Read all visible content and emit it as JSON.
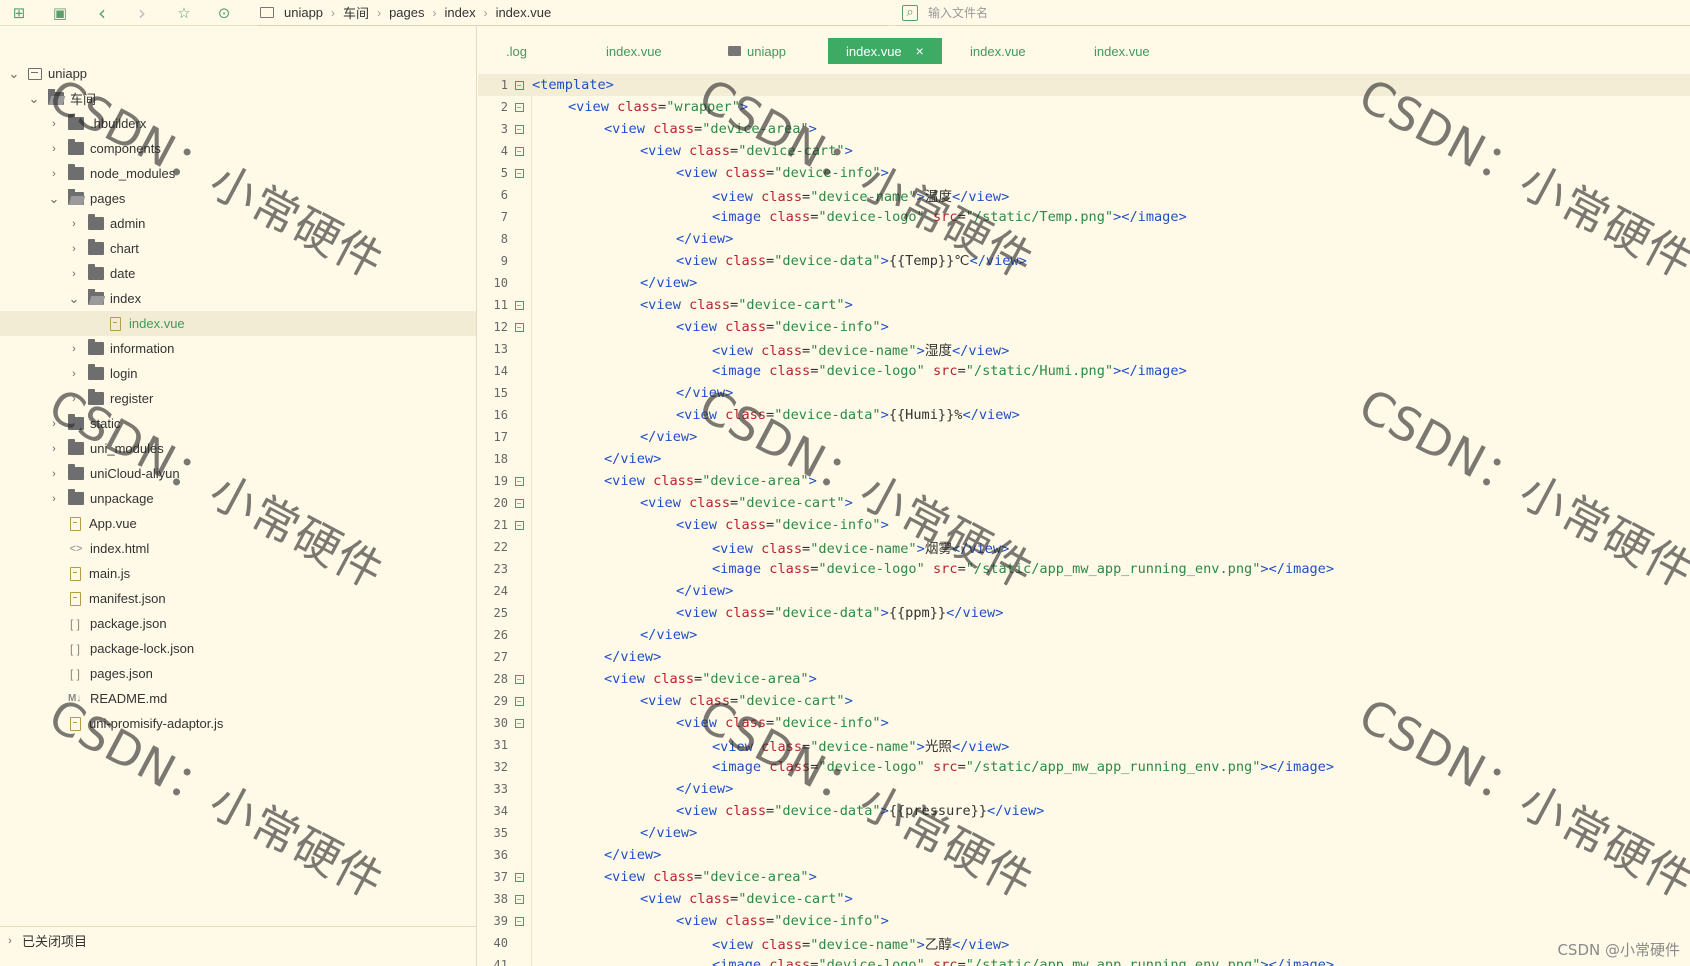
{
  "toolbar": {
    "buttons": [
      "new-file-icon",
      "save-icon",
      "back-icon",
      "forward-icon",
      "star-icon",
      "run-icon"
    ]
  },
  "breadcrumb": [
    "uniapp",
    "车间",
    "pages",
    "index",
    "index.vue"
  ],
  "search": {
    "placeholder": "输入文件名"
  },
  "tree": [
    {
      "label": "uniapp",
      "chev": "open",
      "icon": "project",
      "level": 0
    },
    {
      "label": "车间",
      "chev": "open",
      "icon": "folder-open",
      "level": 1
    },
    {
      "label": ".hbuilderx",
      "chev": "closed",
      "icon": "folder",
      "level": 2
    },
    {
      "label": "components",
      "chev": "closed",
      "icon": "folder",
      "level": 2
    },
    {
      "label": "node_modules",
      "chev": "closed",
      "icon": "folder",
      "level": 2
    },
    {
      "label": "pages",
      "chev": "open",
      "icon": "folder-open",
      "level": 2
    },
    {
      "label": "admin",
      "chev": "closed",
      "icon": "folder",
      "level": 3
    },
    {
      "label": "chart",
      "chev": "closed",
      "icon": "folder",
      "level": 3
    },
    {
      "label": "date",
      "chev": "closed",
      "icon": "folder",
      "level": 3
    },
    {
      "label": "index",
      "chev": "open",
      "icon": "folder-open",
      "level": 3
    },
    {
      "label": "index.vue",
      "chev": "none",
      "icon": "file",
      "level": 4,
      "selected": true
    },
    {
      "label": "information",
      "chev": "closed",
      "icon": "folder",
      "level": 3
    },
    {
      "label": "login",
      "chev": "closed",
      "icon": "folder",
      "level": 3
    },
    {
      "label": "register",
      "chev": "closed",
      "icon": "folder",
      "level": 3
    },
    {
      "label": "static",
      "chev": "closed",
      "icon": "folder",
      "level": 2
    },
    {
      "label": "uni_modules",
      "chev": "closed",
      "icon": "folder",
      "level": 2
    },
    {
      "label": "uniCloud-aliyun",
      "chev": "closed",
      "icon": "folder",
      "level": 2
    },
    {
      "label": "unpackage",
      "chev": "closed",
      "icon": "folder",
      "level": 2
    },
    {
      "label": "App.vue",
      "chev": "none",
      "icon": "file",
      "level": 2
    },
    {
      "label": "index.html",
      "chev": "none",
      "icon": "html",
      "level": 2
    },
    {
      "label": "main.js",
      "chev": "none",
      "icon": "file",
      "level": 2
    },
    {
      "label": "manifest.json",
      "chev": "none",
      "icon": "file",
      "level": 2
    },
    {
      "label": "package.json",
      "chev": "none",
      "icon": "json",
      "level": 2
    },
    {
      "label": "package-lock.json",
      "chev": "none",
      "icon": "json",
      "level": 2
    },
    {
      "label": "pages.json",
      "chev": "none",
      "icon": "json",
      "level": 2
    },
    {
      "label": "README.md",
      "chev": "none",
      "icon": "md",
      "level": 2
    },
    {
      "label": "uni-promisify-adaptor.js",
      "chev": "none",
      "icon": "file",
      "level": 2
    }
  ],
  "closed_projects": "已关闭项目",
  "tabs": [
    {
      "label": ".log",
      "active": false,
      "folder": false
    },
    {
      "label": "index.vue",
      "active": false,
      "folder": false
    },
    {
      "label": "uniapp",
      "active": false,
      "folder": true
    },
    {
      "label": "index.vue",
      "active": true,
      "folder": false
    },
    {
      "label": "index.vue",
      "active": false,
      "folder": false
    },
    {
      "label": "index.vue",
      "active": false,
      "folder": false
    }
  ],
  "code": [
    {
      "n": 1,
      "indent": 0,
      "fold": true,
      "text": "<template>"
    },
    {
      "n": 2,
      "indent": 1,
      "fold": true,
      "text": "<view class=\"wrapper\">"
    },
    {
      "n": 3,
      "indent": 2,
      "fold": true,
      "text": "<view class=\"device-area\">"
    },
    {
      "n": 4,
      "indent": 3,
      "fold": true,
      "text": "<view class=\"device-cart\">"
    },
    {
      "n": 5,
      "indent": 4,
      "fold": true,
      "text": "<view class=\"device-info\">"
    },
    {
      "n": 6,
      "indent": 5,
      "fold": false,
      "text": "<view class=\"device-name\">温度</view>"
    },
    {
      "n": 7,
      "indent": 5,
      "fold": false,
      "text": "<image class=\"device-logo\" src=\"/static/Temp.png\"></image>"
    },
    {
      "n": 8,
      "indent": 4,
      "fold": false,
      "text": "</view>"
    },
    {
      "n": 9,
      "indent": 4,
      "fold": false,
      "text": "<view class=\"device-data\">{{Temp}}℃</view>"
    },
    {
      "n": 10,
      "indent": 3,
      "fold": false,
      "text": "</view>"
    },
    {
      "n": 11,
      "indent": 3,
      "fold": true,
      "text": "<view class=\"device-cart\">"
    },
    {
      "n": 12,
      "indent": 4,
      "fold": true,
      "text": "<view class=\"device-info\">"
    },
    {
      "n": 13,
      "indent": 5,
      "fold": false,
      "text": "<view class=\"device-name\">湿度</view>"
    },
    {
      "n": 14,
      "indent": 5,
      "fold": false,
      "text": "<image class=\"device-logo\" src=\"/static/Humi.png\"></image>"
    },
    {
      "n": 15,
      "indent": 4,
      "fold": false,
      "text": "</view>"
    },
    {
      "n": 16,
      "indent": 4,
      "fold": false,
      "text": "<view class=\"device-data\">{{Humi}}%</view>"
    },
    {
      "n": 17,
      "indent": 3,
      "fold": false,
      "text": "</view>"
    },
    {
      "n": 18,
      "indent": 2,
      "fold": false,
      "text": "</view>"
    },
    {
      "n": 19,
      "indent": 2,
      "fold": true,
      "text": "<view class=\"device-area\">"
    },
    {
      "n": 20,
      "indent": 3,
      "fold": true,
      "text": "<view class=\"device-cart\">"
    },
    {
      "n": 21,
      "indent": 4,
      "fold": true,
      "text": "<view class=\"device-info\">"
    },
    {
      "n": 22,
      "indent": 5,
      "fold": false,
      "text": "<view class=\"device-name\">烟雾</view>"
    },
    {
      "n": 23,
      "indent": 5,
      "fold": false,
      "text": "<image class=\"device-logo\" src=\"/static/app_mw_app_running_env.png\"></image>"
    },
    {
      "n": 24,
      "indent": 4,
      "fold": false,
      "text": "</view>"
    },
    {
      "n": 25,
      "indent": 4,
      "fold": false,
      "text": "<view class=\"device-data\">{{ppm}}</view>"
    },
    {
      "n": 26,
      "indent": 3,
      "fold": false,
      "text": "</view>"
    },
    {
      "n": 27,
      "indent": 2,
      "fold": false,
      "text": "</view>"
    },
    {
      "n": 28,
      "indent": 2,
      "fold": true,
      "text": "<view class=\"device-area\">"
    },
    {
      "n": 29,
      "indent": 3,
      "fold": true,
      "text": "<view class=\"device-cart\">"
    },
    {
      "n": 30,
      "indent": 4,
      "fold": true,
      "text": "<view class=\"device-info\">"
    },
    {
      "n": 31,
      "indent": 5,
      "fold": false,
      "text": "<view class=\"device-name\">光照</view>"
    },
    {
      "n": 32,
      "indent": 5,
      "fold": false,
      "text": "<image class=\"device-logo\" src=\"/static/app_mw_app_running_env.png\"></image>"
    },
    {
      "n": 33,
      "indent": 4,
      "fold": false,
      "text": "</view>"
    },
    {
      "n": 34,
      "indent": 4,
      "fold": false,
      "text": "<view class=\"device-data\">{{pressure}}</view>"
    },
    {
      "n": 35,
      "indent": 3,
      "fold": false,
      "text": "</view>"
    },
    {
      "n": 36,
      "indent": 2,
      "fold": false,
      "text": "</view>"
    },
    {
      "n": 37,
      "indent": 2,
      "fold": true,
      "text": "<view class=\"device-area\">"
    },
    {
      "n": 38,
      "indent": 3,
      "fold": true,
      "text": "<view class=\"device-cart\">"
    },
    {
      "n": 39,
      "indent": 4,
      "fold": true,
      "text": "<view class=\"device-info\">"
    },
    {
      "n": 40,
      "indent": 5,
      "fold": false,
      "text": "<view class=\"device-name\">乙醇</view>"
    },
    {
      "n": 41,
      "indent": 5,
      "fold": false,
      "text": "<image class=\"device-logo\" src=\"/static/app_mw_app_running_env.png\"></image>"
    }
  ],
  "watermark": "CSDN：小常硬件",
  "footer_watermark": "CSDN @小常硬件",
  "colors": {
    "accent": "#3dab63",
    "tag": "#1f4fc8",
    "attr": "#b8222f",
    "string": "#2b8a47",
    "background": "#fffae8"
  }
}
